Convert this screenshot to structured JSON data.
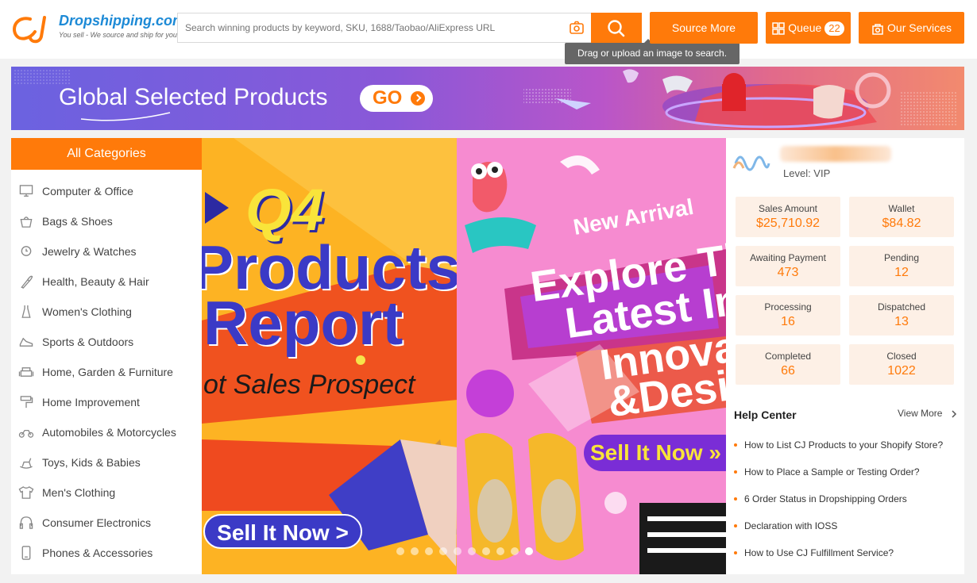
{
  "header": {
    "logo_name": "Dropshipping.com",
    "logo_tagline": "You sell - We source and ship for you!",
    "search_placeholder": "Search winning products by keyword, SKU, 1688/Taobao/AliExpress URL",
    "tooltip": "Drag or upload an image to search.",
    "source_more": "Source More",
    "queue_label": "Queue",
    "queue_count": "22",
    "services_label": "Our Services",
    "brand_color": "#ff7a0a"
  },
  "banner": {
    "title": "Global Selected Products",
    "go_label": "GO"
  },
  "categories": {
    "header": "All Categories",
    "items": [
      {
        "label": "Computer & Office",
        "icon": "monitor-icon"
      },
      {
        "label": "Bags & Shoes",
        "icon": "bag-icon"
      },
      {
        "label": "Jewelry & Watches",
        "icon": "watch-icon"
      },
      {
        "label": "Health, Beauty & Hair",
        "icon": "brush-icon"
      },
      {
        "label": "Women's Clothing",
        "icon": "dress-icon"
      },
      {
        "label": "Sports & Outdoors",
        "icon": "sneaker-icon"
      },
      {
        "label": "Home, Garden & Furniture",
        "icon": "sofa-icon"
      },
      {
        "label": "Home Improvement",
        "icon": "paint-roller-icon"
      },
      {
        "label": "Automobiles & Motorcycles",
        "icon": "motorcycle-icon"
      },
      {
        "label": "Toys, Kids & Babies",
        "icon": "rocking-horse-icon"
      },
      {
        "label": "Men's Clothing",
        "icon": "tshirt-icon"
      },
      {
        "label": "Consumer Electronics",
        "icon": "headphones-icon"
      },
      {
        "label": "Phones & Accessories",
        "icon": "phone-icon"
      }
    ]
  },
  "hero": {
    "slide_a": {
      "badge": "Q4",
      "title_line1": "Products",
      "title_line2": "Report",
      "subtitle": "ot Sales Prospect",
      "cta": "Sell It Now >"
    },
    "slide_b": {
      "tag": "New Arrival",
      "title_line1": "Explore Th",
      "title_line2": "Latest In",
      "title_line3": "Innova",
      "title_line4": "&Desi",
      "cta": "Sell It Now »"
    },
    "dot_count": 10,
    "active_dot": 9
  },
  "account": {
    "level": "Level: VIP",
    "stats": [
      {
        "label": "Sales Amount",
        "value": "$25,710.92"
      },
      {
        "label": "Wallet",
        "value": "$84.82"
      },
      {
        "label": "Awaiting Payment",
        "value": "473"
      },
      {
        "label": "Pending",
        "value": "12"
      },
      {
        "label": "Processing",
        "value": "16"
      },
      {
        "label": "Dispatched",
        "value": "13"
      },
      {
        "label": "Completed",
        "value": "66"
      },
      {
        "label": "Closed",
        "value": "1022"
      }
    ]
  },
  "help": {
    "title": "Help Center",
    "view_more": "View More",
    "links": [
      "How to List CJ Products to your Shopify Store?",
      "How to Place a Sample or Testing Order?",
      "6 Order Status in Dropshipping Orders",
      "Declaration with IOSS",
      "How to Use CJ Fulfillment Service?"
    ]
  }
}
